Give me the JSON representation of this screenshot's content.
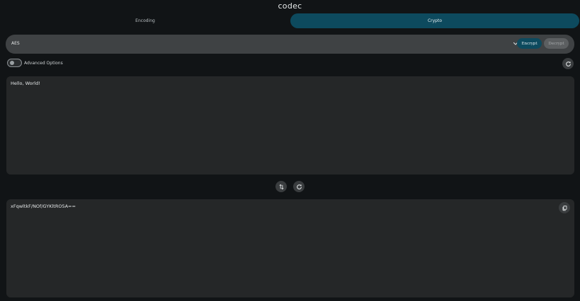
{
  "app": {
    "title": "codec"
  },
  "tabs": [
    {
      "label": "Encoding",
      "active": false
    },
    {
      "label": "Crypto",
      "active": true
    }
  ],
  "crypto": {
    "algorithm": "AES",
    "encrypt_label": "Encrypt",
    "decrypt_label": "Decrypt",
    "mode": "Encrypt"
  },
  "options": {
    "advanced_label": "Advanced Options",
    "advanced_enabled": false
  },
  "input": {
    "value": "Hello, World!"
  },
  "output": {
    "value": "xFqwltkF/NOf/GYKltRO5A=="
  },
  "icons": {
    "dropdown": "chevron-down-icon",
    "reset": "refresh-icon",
    "swap": "swap-vertical-icon",
    "copy": "copy-icon"
  },
  "colors": {
    "accent": "#0d4a5e",
    "background": "#111416",
    "panel": "#252728",
    "bar": "#3f4244"
  }
}
